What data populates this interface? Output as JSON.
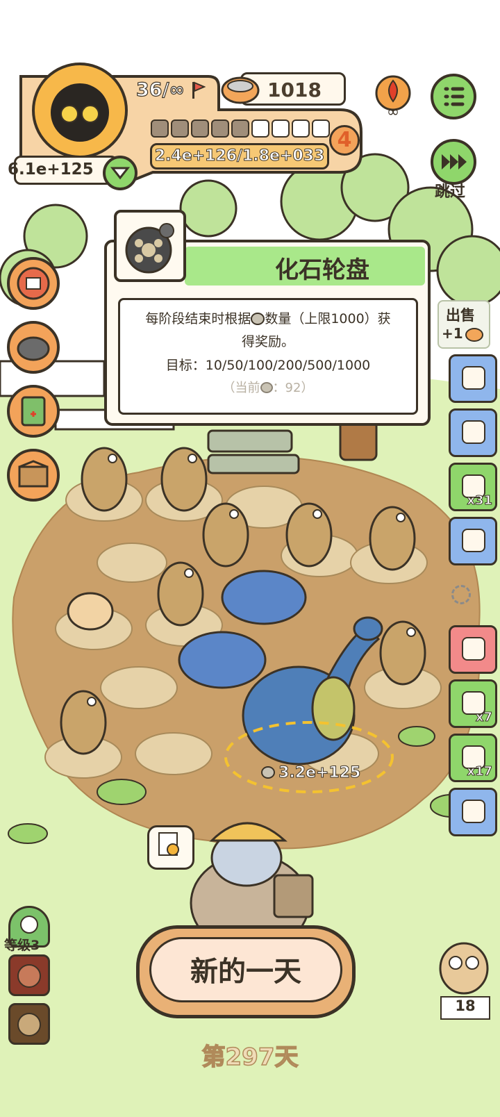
{
  "hud": {
    "stage_progress": "36/∞",
    "coins": "1018",
    "player_value": "6.1e+125",
    "progress_filled_segments": 5,
    "progress_total_segments": 9,
    "level_badge": "4",
    "score_ratio": "2.4e+126/1.8e+033"
  },
  "skip": {
    "label": "跳过"
  },
  "popup": {
    "title": "化石轮盘",
    "desc_line1": "每阶段结束时根据",
    "desc_line1b": "数量（上限1000）获",
    "desc_line2": "得奖励。",
    "target": "目标：10/50/100/200/500/1000",
    "current_prefix": "（当前",
    "current_suffix": "：92）"
  },
  "sell": {
    "label": "出售",
    "bonus": "+1"
  },
  "right_items": [
    {
      "name": "hut",
      "qty": ""
    },
    {
      "name": "leaf",
      "qty": ""
    },
    {
      "name": "ticket",
      "qty": "x31"
    },
    {
      "name": "camera",
      "qty": ""
    },
    {
      "name": "egg",
      "qty": ""
    },
    {
      "name": "bag",
      "qty": "x7"
    },
    {
      "name": "helmet",
      "qty": "x17"
    },
    {
      "name": "box",
      "qty": ""
    }
  ],
  "field": {
    "yield": "3.2e+125"
  },
  "bottom": {
    "level_label": "等级3",
    "new_day": "新的一天",
    "day": "第297天",
    "owl_count": "18"
  },
  "colors": {
    "grass": "#d9efb0",
    "dirt": "#caa06a",
    "orange": "#f3a35a",
    "green_btn": "#8fd66b",
    "blue_slot": "#8fb6ec",
    "title_green": "#a9e88a",
    "ink": "#3b3226"
  }
}
